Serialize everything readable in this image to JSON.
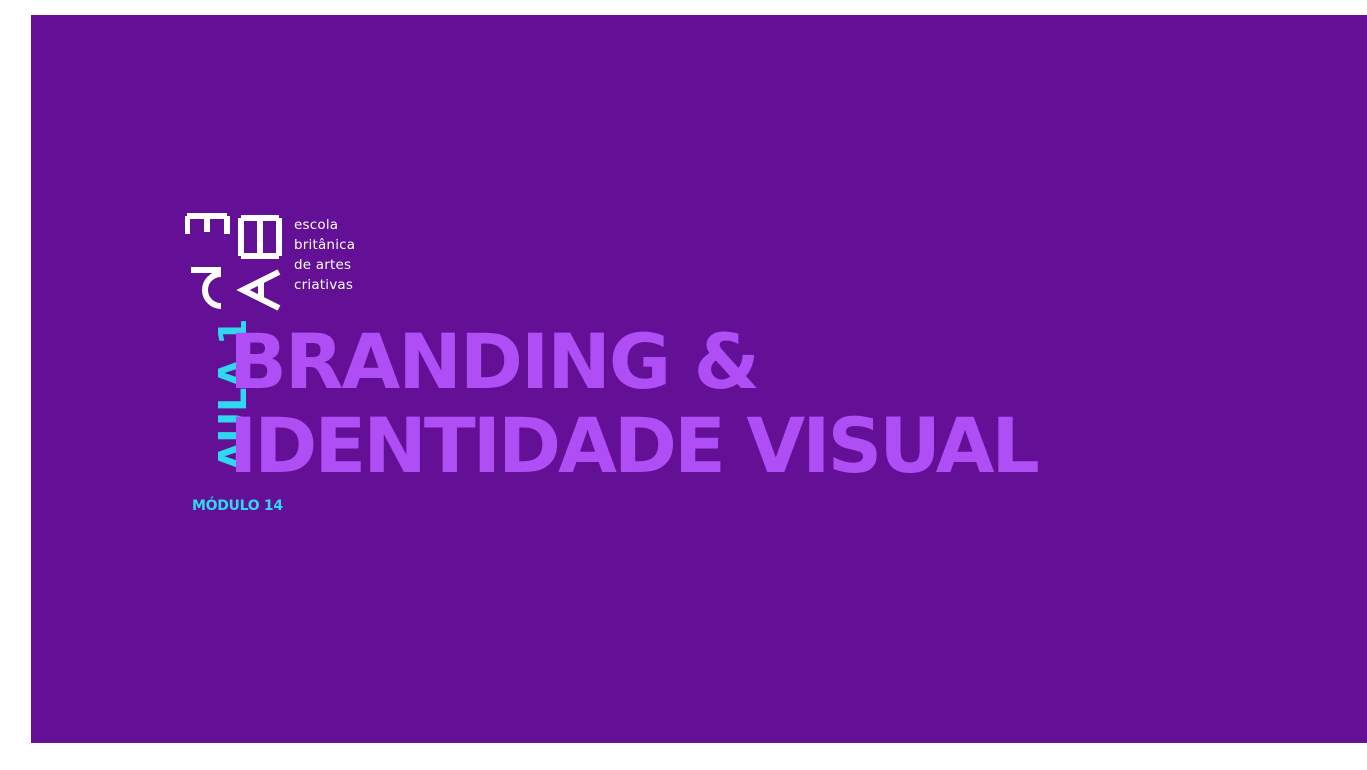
{
  "slide": {
    "background_color": "#631096",
    "logo": {
      "lines": [
        "escola",
        "britânica",
        "de artes",
        "criativas"
      ]
    },
    "aula_label": "AULA 1",
    "title_line_1": "BRANDING &",
    "title_line_2": "IDENTIDADE VISUAL",
    "modulo_label": "MÓDULO 14",
    "colors": {
      "title": "#b04ef6",
      "accent": "#2fd8ee",
      "logo": "#ffffff"
    }
  }
}
